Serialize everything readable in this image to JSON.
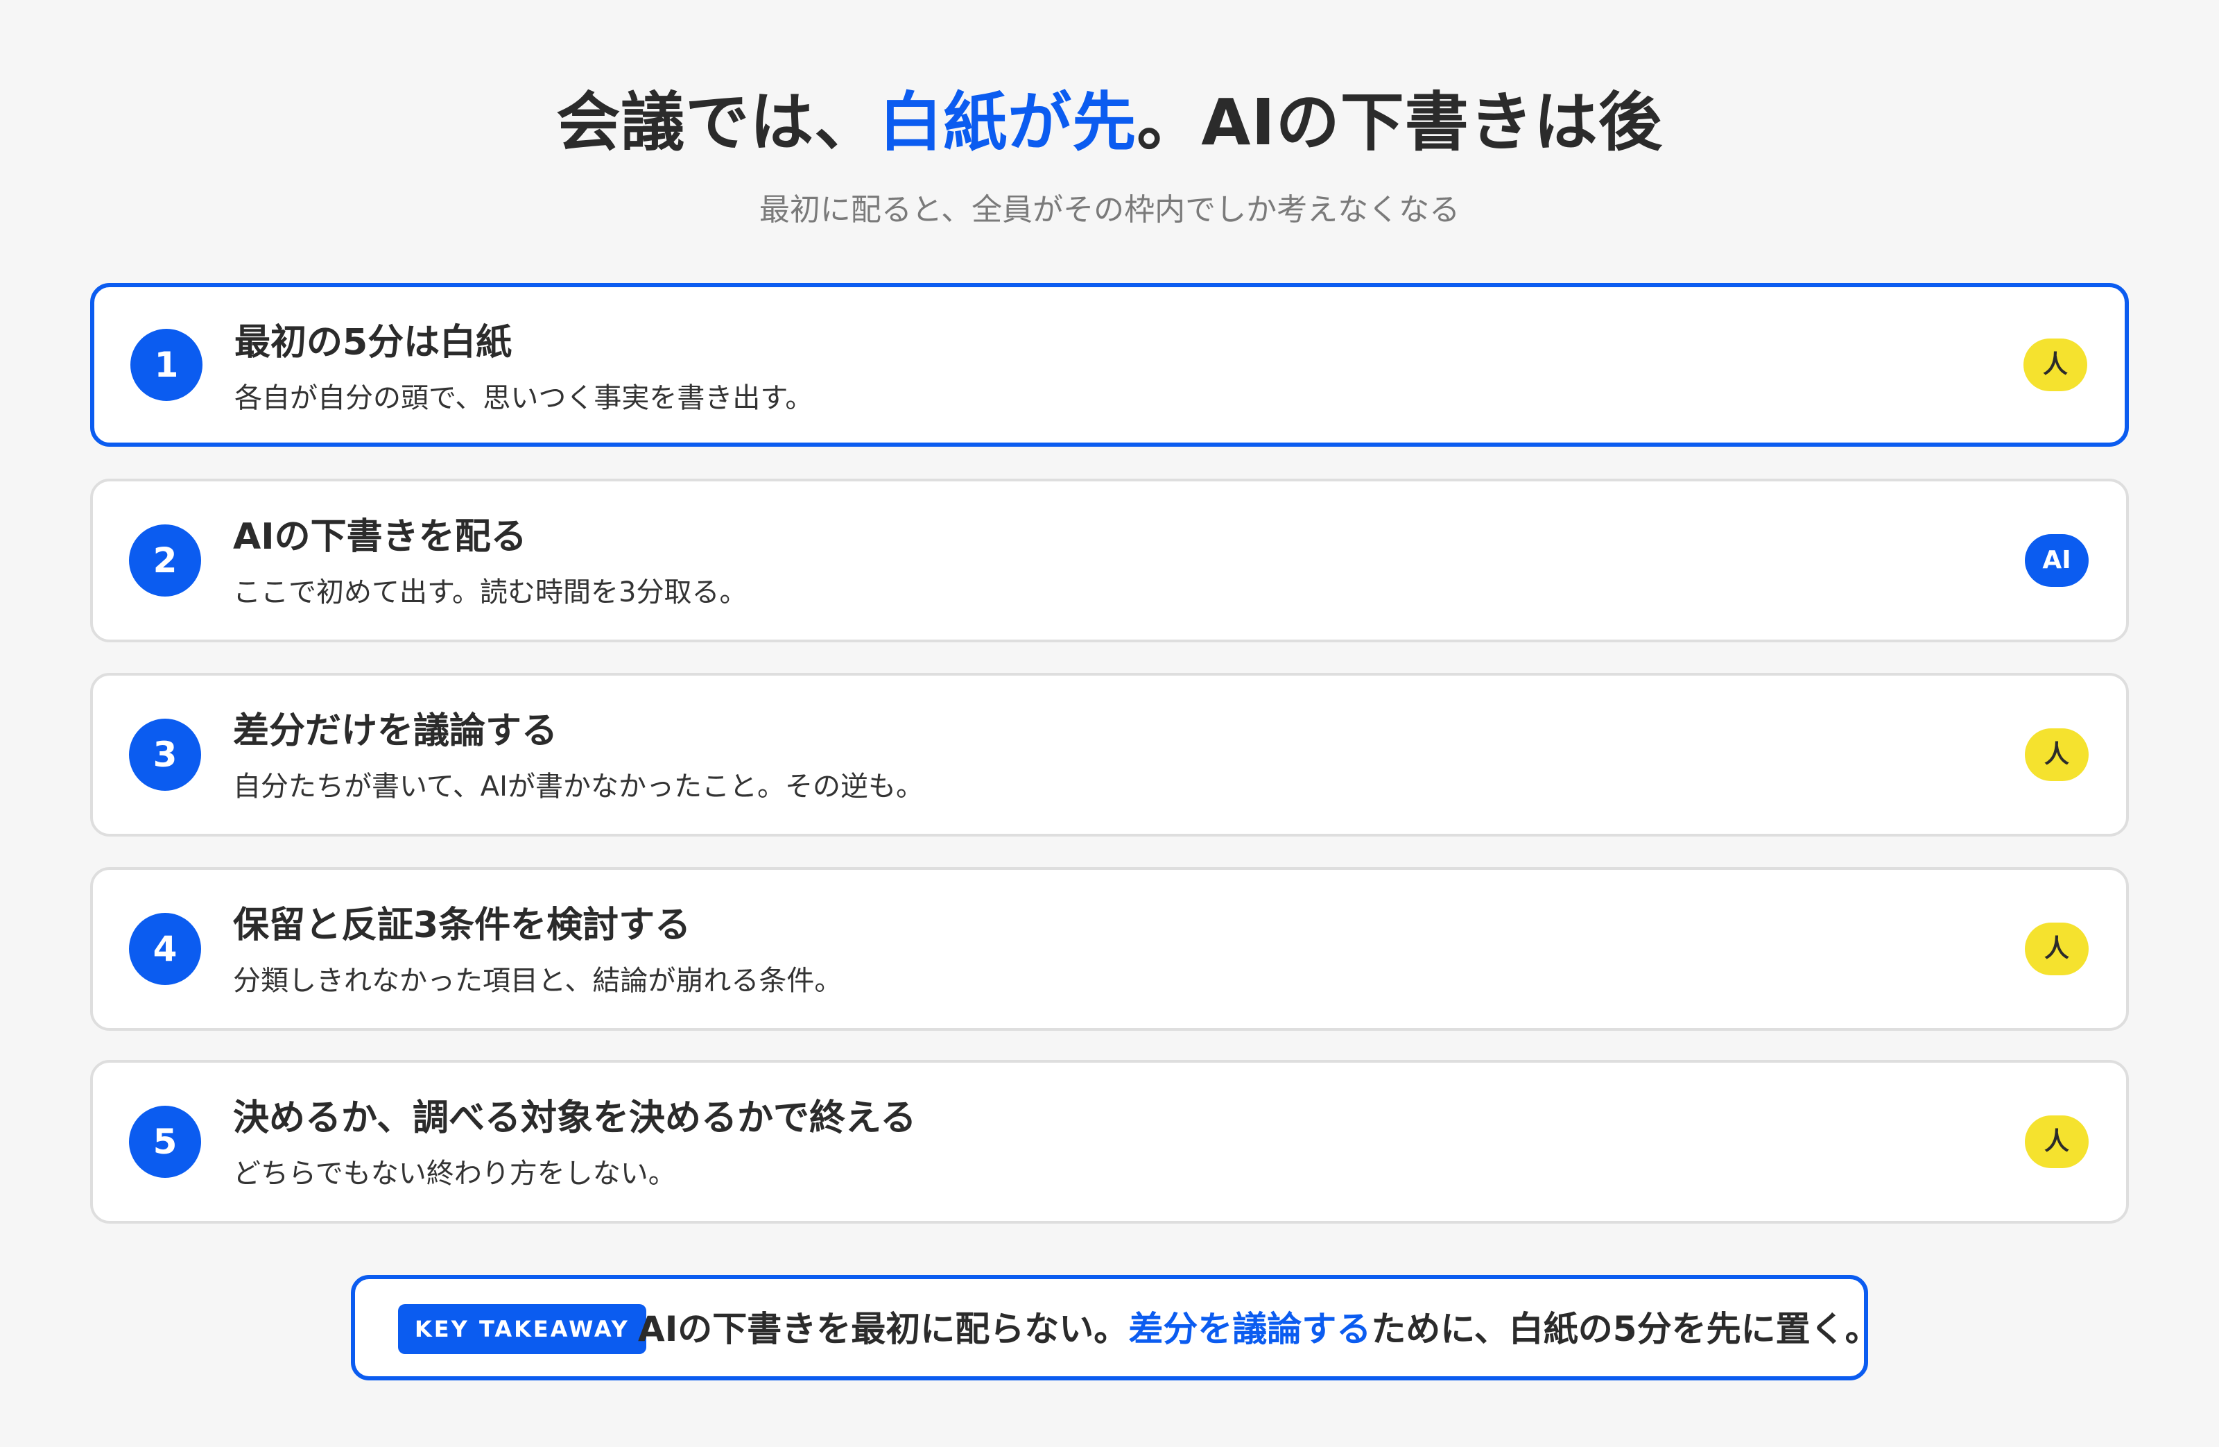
{
  "header": {
    "title_pre": "会議では、",
    "title_accent": "白紙が先",
    "title_post": "。AIの下書きは後",
    "subtitle": "最初に配ると、全員がその枠内でしか考えなくなる"
  },
  "steps": [
    {
      "number": "1",
      "title": "最初の5分は白紙",
      "description": "各自が自分の頭で、思いつく事実を書き出す。",
      "badge": "人"
    },
    {
      "number": "2",
      "title": "AIの下書きを配る",
      "description": "ここで初めて出す。読む時間を3分取る。",
      "badge": "AI"
    },
    {
      "number": "3",
      "title": "差分だけを議論する",
      "description": "自分たちが書いて、AIが書かなかったこと。その逆も。",
      "badge": "人"
    },
    {
      "number": "4",
      "title": "保留と反証3条件を検討する",
      "description": "分類しきれなかった項目と、結論が崩れる条件。",
      "badge": "人"
    },
    {
      "number": "5",
      "title": "決めるか、調べる対象を決めるかで終える",
      "description": "どちらでもない終わり方をしない。",
      "badge": "人"
    }
  ],
  "takeaway": {
    "tag": "KEY TAKEAWAY",
    "text_pre": "AIの下書きを最初に配らない。",
    "text_accent": "差分を議論する",
    "text_post": "ために、白紙の5分を先に置く。"
  },
  "colors": {
    "accent": "#0b5cf0",
    "human_badge": "#f5e22e",
    "background": "#f6f6f6"
  }
}
